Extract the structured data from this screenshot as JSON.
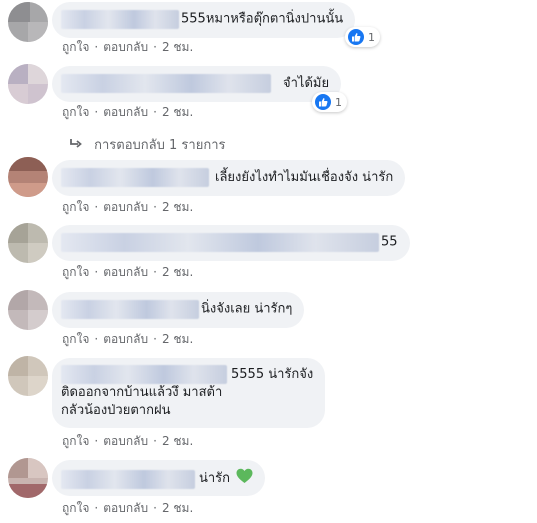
{
  "actions": {
    "like": "ถูกใจ",
    "reply": "ตอบกลับ",
    "time": "2 ชม."
  },
  "comments": [
    {
      "text": "555หมาหรือตุ๊กตานิ่งปานนั้น",
      "reaction_count": "1"
    },
    {
      "text": "จำได้มัย",
      "reaction_count": "1"
    },
    {
      "text": "เลี้ยงยังไงทำไมมันเชื่องจัง น่ารัก"
    },
    {
      "text": "55"
    },
    {
      "text": "นิ่งจังเลย น่ารักๆ"
    },
    {
      "text": "5555 น่ารักจัง",
      "text_line2": "ติดออกจากบ้านแล้วงึ มาสต้า",
      "text_line3": "กลัวน้องป่วยตากฝน"
    },
    {
      "text": "น่ารัก",
      "emoji": "green-heart-icon"
    }
  ],
  "replies_link": {
    "label": "การตอบกลับ 1 รายการ"
  },
  "colors": {
    "bubble": "#f0f2f5",
    "meta": "#65676b",
    "like_blue": "#1877f2",
    "heart_green": "#5cb85c"
  }
}
